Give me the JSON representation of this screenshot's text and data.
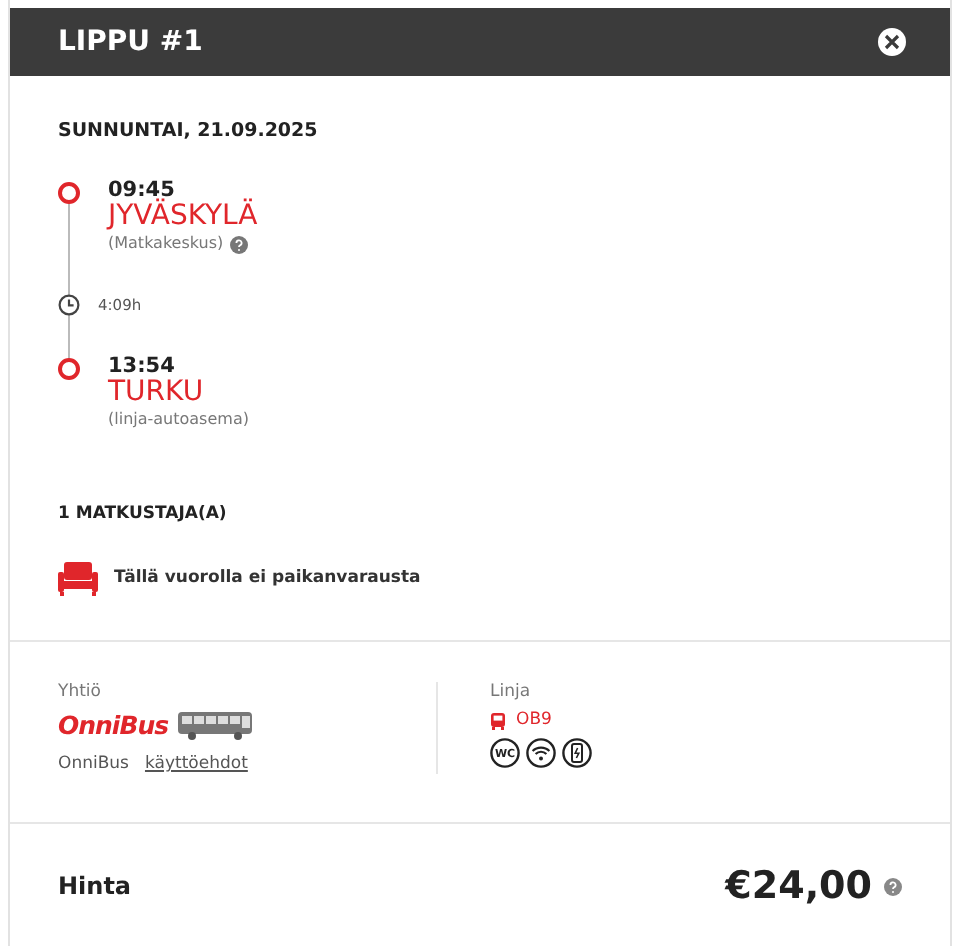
{
  "header": {
    "title": "LIPPU #1"
  },
  "date": "SUNNUNTAI, 21.09.2025",
  "stops": [
    {
      "time": "09:45",
      "city": "JYVÄSKYLÄ",
      "station": "(Matkakeskus)",
      "info": true
    },
    {
      "time": "13:54",
      "city": "TURKU",
      "station": "(linja-autoasema)",
      "info": false
    }
  ],
  "duration": "4:09h",
  "passengers": "1 MATKUSTAJA(A)",
  "seat_notice": "Tällä vuorolla ei paikanvarausta",
  "company": {
    "label": "Yhtiö",
    "logo_text": "OnniBus",
    "name": "OnniBus",
    "terms_link": "käyttöehdot"
  },
  "line": {
    "label": "Linja",
    "code": "OB9",
    "amenities": [
      {
        "kind": "wc",
        "label": "WC"
      },
      {
        "kind": "wifi"
      },
      {
        "kind": "charging"
      }
    ]
  },
  "price": {
    "label": "Hinta",
    "value": "€24,00"
  }
}
